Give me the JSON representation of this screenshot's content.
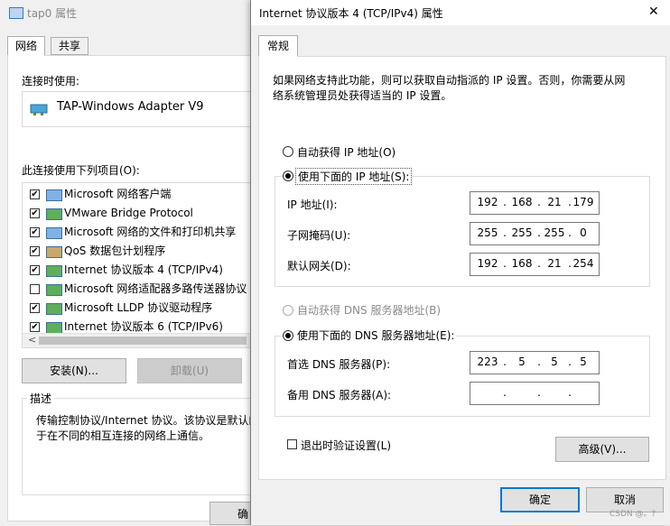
{
  "back_window": {
    "title": "tap0 属性",
    "tabs": [
      "网络",
      "共享"
    ],
    "connect_using_label": "连接时使用:",
    "adapter_name": "TAP-Windows Adapter V9",
    "items_label": "此连接使用下列项目(O):",
    "items": [
      {
        "label": "Microsoft 网络客户端",
        "checked": true
      },
      {
        "label": "VMware Bridge Protocol",
        "checked": true
      },
      {
        "label": "Microsoft 网络的文件和打印机共享",
        "checked": true
      },
      {
        "label": "QoS 数据包计划程序",
        "checked": true
      },
      {
        "label": "Internet 协议版本 4 (TCP/IPv4)",
        "checked": true
      },
      {
        "label": "Microsoft 网络适配器多路传送器协议",
        "checked": false
      },
      {
        "label": "Microsoft LLDP 协议驱动程序",
        "checked": true
      },
      {
        "label": "Internet 协议版本 6 (TCP/IPv6)",
        "checked": true
      }
    ],
    "scroll_left": "<",
    "install_button": "安装(N)...",
    "uninstall_button": "卸载(U)",
    "description_label": "描述",
    "description_text": "传输控制协议/Internet 协议。该协议是默认的广域网络协议，用于在不同的相互连接的网络上通信。",
    "description_line1": "传输控制协议/Internet 协议。该协议是默认的",
    "description_line2": "于在不同的相互连接的网络上通信。",
    "ok_fragment": "确"
  },
  "dialog": {
    "title": "Internet 协议版本 4 (TCP/IPv4) 属性",
    "close_glyph": "✕",
    "tab": "常规",
    "intro_line1": "如果网络支持此功能，则可以获取自动指派的 IP 设置。否则，你需要从网",
    "intro_line2": "络系统管理员处获得适当的 IP 设置。",
    "auto_ip": "自动获得 IP 地址(O)",
    "manual_ip": "使用下面的 IP 地址(S):",
    "ip_label": "IP 地址(I):",
    "ip_address": [
      "192",
      "168",
      "21",
      "179"
    ],
    "subnet_label": "子网掩码(U):",
    "subnet_mask": [
      "255",
      "255",
      "255",
      "0"
    ],
    "gateway_label": "默认网关(D):",
    "gateway": [
      "192",
      "168",
      "21",
      "254"
    ],
    "auto_dns": "自动获得 DNS 服务器地址(B)",
    "manual_dns": "使用下面的 DNS 服务器地址(E):",
    "preferred_dns_label": "首选 DNS 服务器(P):",
    "preferred_dns": [
      "223",
      "5",
      "5",
      "5"
    ],
    "alternate_dns_label": "备用 DNS 服务器(A):",
    "alternate_dns": [
      "",
      "",
      "",
      ""
    ],
    "validate_label": "退出时验证设置(L)",
    "validate_checked": false,
    "advanced_button": "高级(V)...",
    "ok_button": "确定",
    "cancel_button": "取消",
    "manual_ip_selected": true,
    "manual_dns_selected": true
  },
  "watermark": "CSDN @。?",
  "colors": {
    "accent": "#0078d7",
    "window_bg": "#f0f0f0"
  }
}
